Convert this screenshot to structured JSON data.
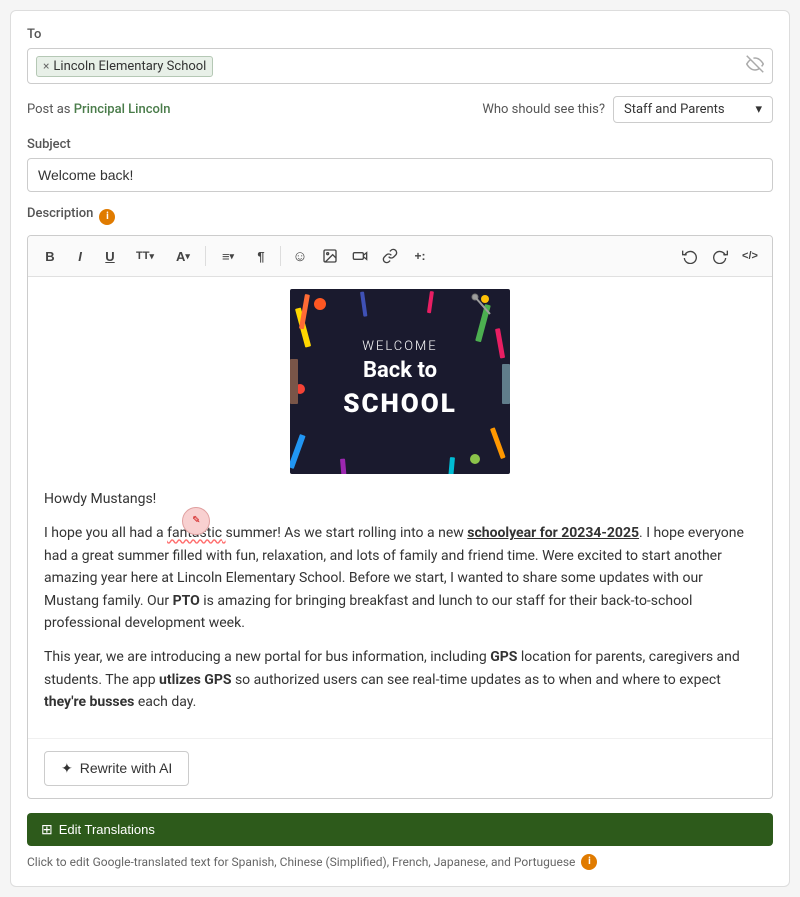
{
  "to": {
    "label": "To",
    "tag": "Lincoln Elementary School",
    "tag_x": "×"
  },
  "post_as": {
    "label": "Post as",
    "name": "Principal Lincoln"
  },
  "who_sees": {
    "label": "Who should see this?",
    "value": "Staff and Parents",
    "dropdown_arrow": "▾"
  },
  "subject": {
    "label": "Subject",
    "value": "Welcome back!"
  },
  "description": {
    "label": "Description"
  },
  "toolbar": {
    "bold": "B",
    "italic": "I",
    "underline": "U",
    "font_size": "TT",
    "font": "A",
    "align": "≡",
    "paragraph": "¶",
    "emoji": "☺",
    "image": "🖼",
    "video": "▶",
    "link": "🔗",
    "plus": "+:",
    "undo": "↩",
    "redo": "↪",
    "code": "</>",
    "font_size_arrow": "▾",
    "font_arrow": "▾",
    "align_arrow": "▾"
  },
  "image_alt": "Welcome Back to School",
  "content": {
    "greeting": "Howdy Mustangs!",
    "para1_before_highlight": "I hope you all had a ",
    "highlight_word": "fantastic",
    "para1_after_highlight": " summer! As we start rolling into a new ",
    "underline_bold_phrase": "schoolyear for 20234-2025",
    "para1_rest": ". I hope everyone had a great summer filled with fun, relaxation, and lots of family and friend time. Were excited to start another amazing year here at Lincoln Elementary School. Before we start, I wanted to share some updates with our Mustang family. Our ",
    "pto_bold": "PTO",
    "para1_end": " is amazing for bringing breakfast and lunch to our staff for their back-to-school professional development week.",
    "para2_before": "This year, we are introducing a new portal for bus information, including ",
    "gps_bold": "GPS",
    "para2_middle": " location for parents, caregivers and students. The app ",
    "utlizes_bold": "utlizes GPS",
    "para2_end": " so authorized users can see real-time updates as to when and where to expect ",
    "busses_bold": "they're busses",
    "para2_final": " each day."
  },
  "rewrite_btn": {
    "icon": "✦",
    "label": "Rewrite with AI"
  },
  "edit_translations": {
    "label": "Edit Translations",
    "icon": "⊞"
  },
  "translation_note": "Click to edit Google-translated text for Spanish, Chinese (Simplified), French, Japanese, and Portuguese"
}
